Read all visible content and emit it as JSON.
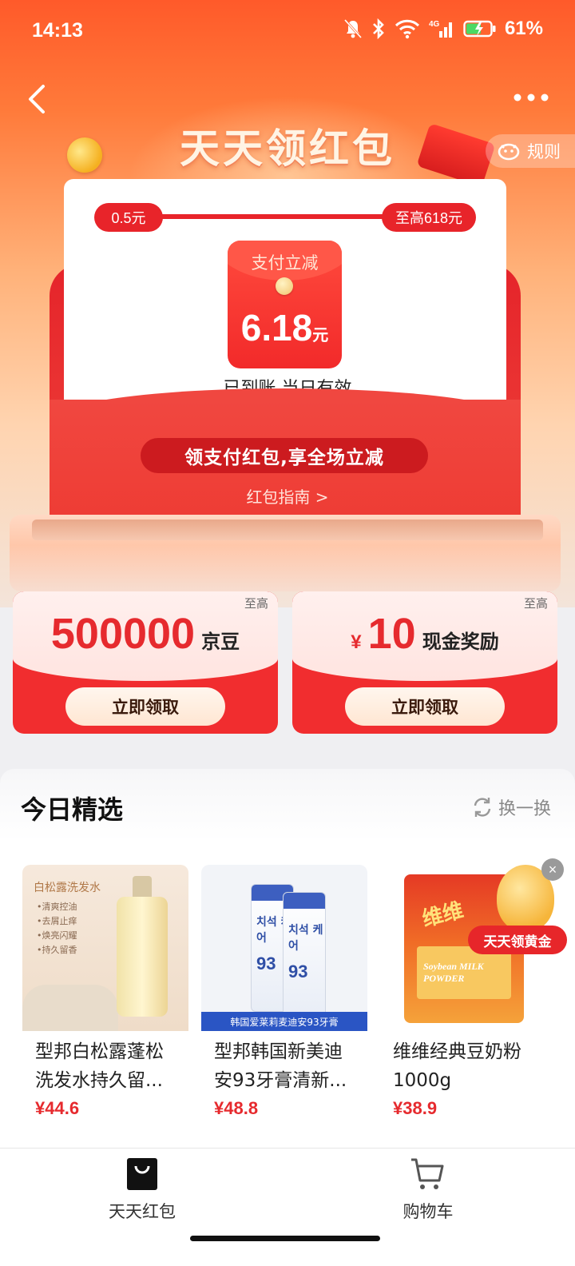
{
  "status_bar": {
    "time": "14:13",
    "network": "4G",
    "battery_percent": "61%"
  },
  "header": {
    "title": "天天领红包",
    "rules_label": "规则",
    "back_icon": "chevron-left-icon",
    "more_icon": "more-dots-icon"
  },
  "envelope": {
    "progress_min": "0.5元",
    "progress_max": "至高618元",
    "coupon_label": "支付立减",
    "coupon_amount": "6.18",
    "coupon_unit": "元",
    "status": "已到账 当日有效",
    "slogan": "领支付红包,享全场立减",
    "guide_link": "红包指南 >"
  },
  "rewards": [
    {
      "tag": "至高",
      "currency": "",
      "value": "500000",
      "suffix": "京豆",
      "button": "立即领取"
    },
    {
      "tag": "至高",
      "currency": "¥",
      "value": "10",
      "suffix": "现金奖励",
      "button": "立即领取"
    }
  ],
  "picks": {
    "title": "今日精选",
    "refresh_label": "换一换",
    "products": [
      {
        "name": "型邦白松露蓬松洗发水持久留...",
        "price": "¥44.6",
        "image_text": {
          "title": "白松露洗发水",
          "bullets": [
            "•清爽控油",
            "•去屑止痒",
            "•焕亮闪耀",
            "•持久留香"
          ]
        }
      },
      {
        "name": "型邦韩国新美迪安93牙膏清新...",
        "price": "¥48.8",
        "image_text": {
          "tube_korean": "치석 케어",
          "tube_number": "93",
          "banner": "韩国爱莱莉麦迪安93牙膏"
        }
      },
      {
        "name": "维维经典豆奶粉1000g",
        "price": "¥38.9",
        "image_text": {
          "logo": "维维",
          "label": "Soybean MILK POWDER"
        }
      }
    ]
  },
  "gold_promo": {
    "label": "天天领黄金",
    "close": "×"
  },
  "tabbar": {
    "tabs": [
      {
        "label": "天天红包",
        "icon": "shopping-bag-icon"
      },
      {
        "label": "购物车",
        "icon": "cart-icon"
      }
    ]
  },
  "colors": {
    "brand_red": "#e8242a",
    "price_red": "#e62a2e",
    "header_orange": "#ff5a2a"
  }
}
